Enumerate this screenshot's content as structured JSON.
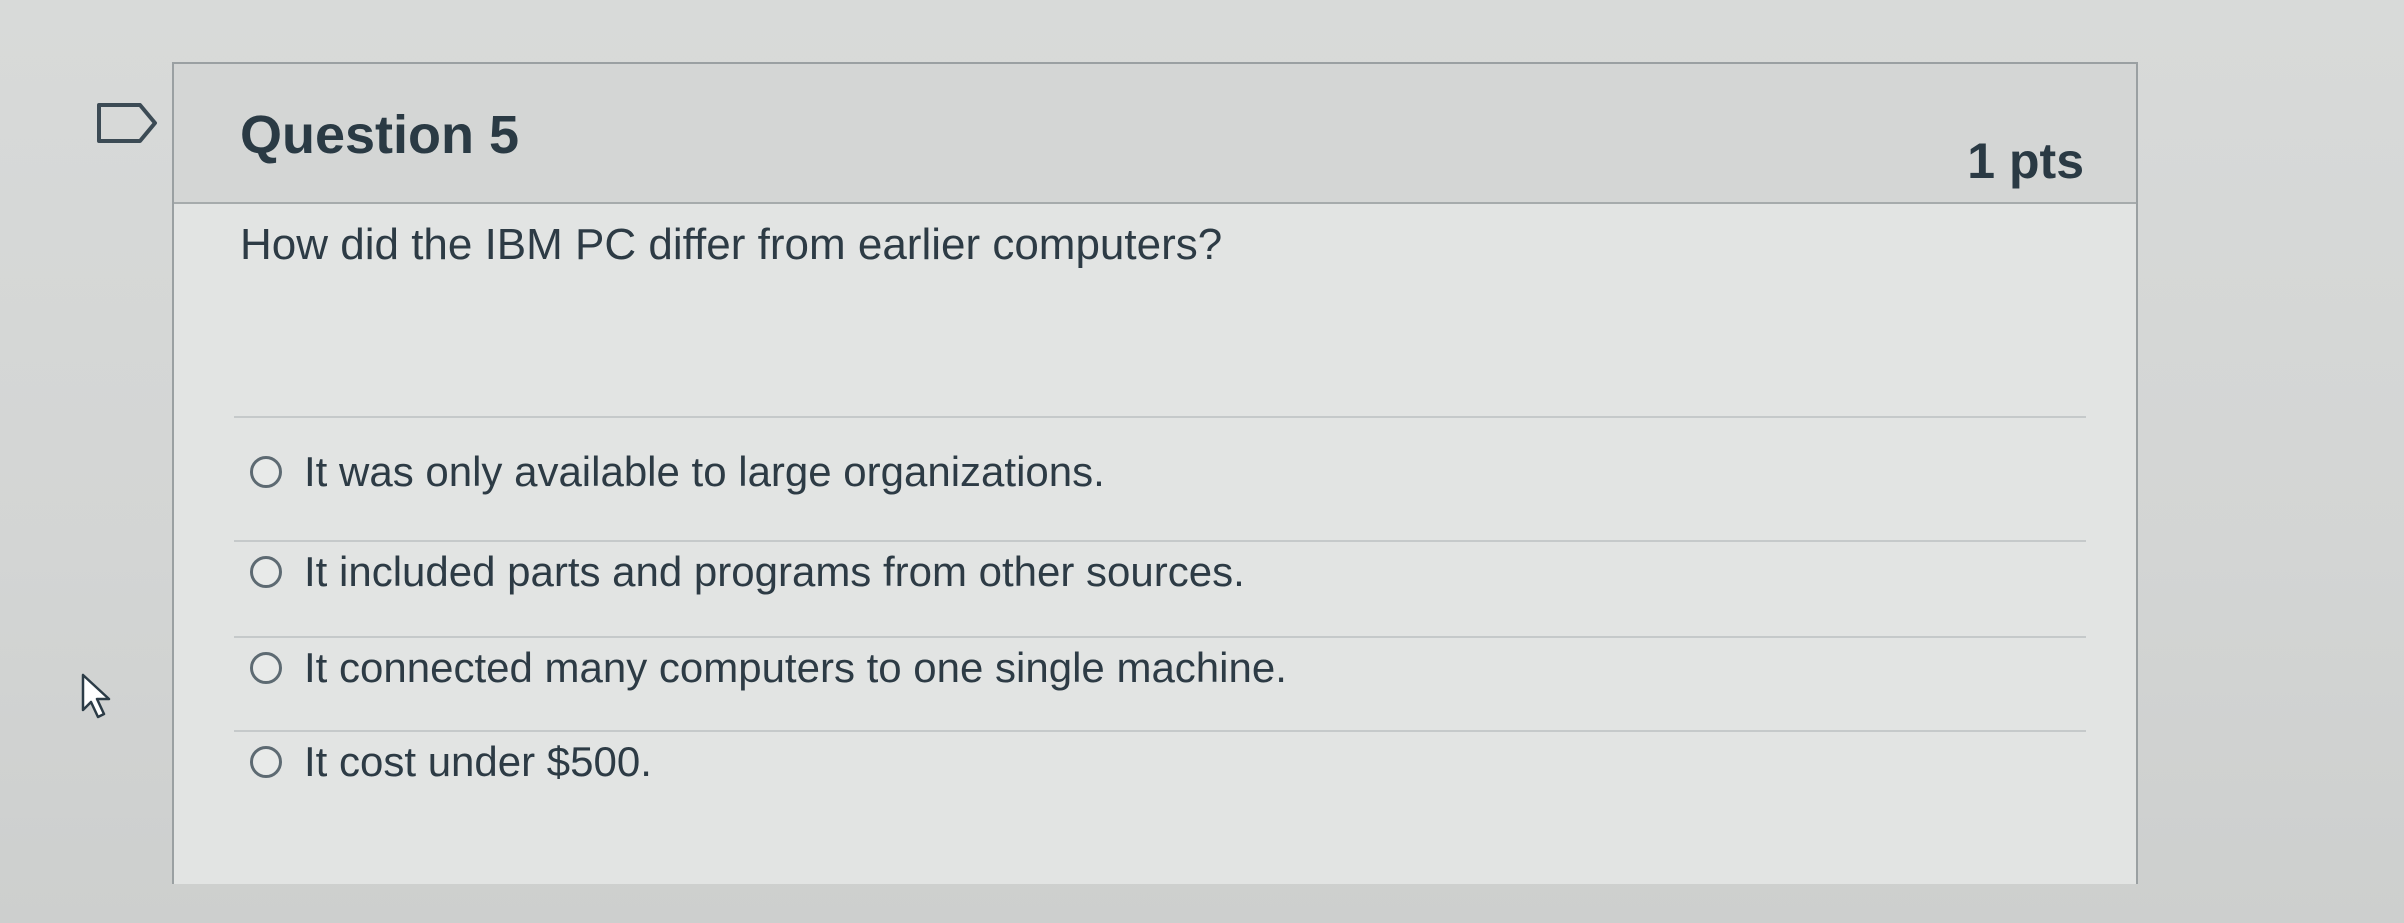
{
  "question": {
    "title": "Question 5",
    "points": "1 pts",
    "text": "How did the IBM PC differ from earlier computers?",
    "answers": [
      "It was only available to large organizations.",
      "It included parts and programs from other sources.",
      "It connected many computers to one single machine.",
      "It cost under $500."
    ]
  },
  "icons": {
    "flag": "flag-icon",
    "cursor": "mouse-pointer-icon"
  },
  "colors": {
    "page_background": "#d6d8d7",
    "card_background": "#e2e4e3",
    "header_background": "#d4d6d5",
    "text": "#2d3b45",
    "border": "#9aa0a2"
  }
}
